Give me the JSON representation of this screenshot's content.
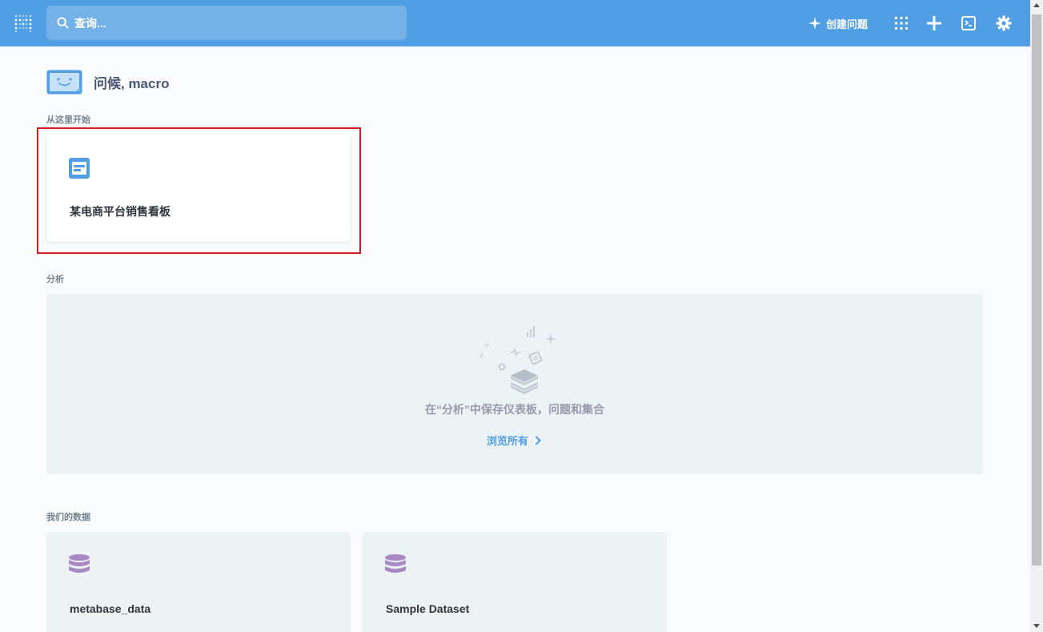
{
  "nav": {
    "search_placeholder": "查询...",
    "create_question_label": "创建问题",
    "icons": [
      "metabase-logo-icon",
      "search-icon",
      "sparkle-icon",
      "grid-icon",
      "plus-icon",
      "terminal-icon",
      "gear-icon"
    ]
  },
  "greeting": "问候, macro",
  "sections": {
    "start_here": "从这里开始",
    "analytics": "分析",
    "our_data": "我们的数据"
  },
  "start_cards": [
    {
      "title": "某电商平台销售看板",
      "icon": "dashboard-icon"
    }
  ],
  "analytics_empty": {
    "message": "在“分析”中保存仪表板，问题和集合",
    "browse_label": "浏览所有"
  },
  "databases": [
    {
      "name": "metabase_data",
      "icon": "database-icon"
    },
    {
      "name": "Sample Dataset",
      "icon": "database-icon"
    }
  ],
  "colors": {
    "brand": "#509ee3",
    "highlight": "#d42020",
    "database_icon": "#a989c5"
  }
}
